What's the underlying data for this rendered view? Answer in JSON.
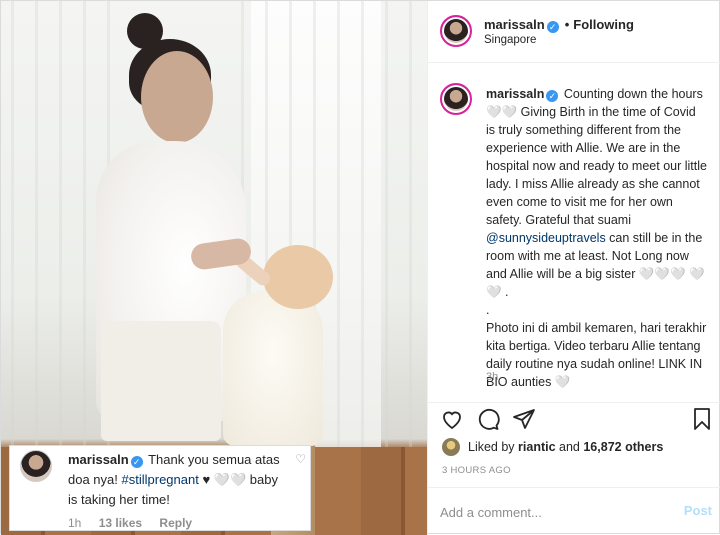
{
  "post": {
    "username": "marissaln",
    "follow_status": "Following",
    "location": "Singapore",
    "caption_pre": " Counting down the hours 🤍🤍 Giving Birth in the time of Covid is truly something different from the experience with Allie. We are in the hospital now and ready to meet our little lady. I miss Allie already as she cannot even come to visit me for her own safety. Grateful that suami ",
    "caption_mention": "@sunnysideuptravels",
    "caption_post": " can still be in the room with me at least. Not Long now and Allie will be a big sister 🤍🤍🤍 🤍🤍 .\n.\nPhoto ini di ambil kemaren, hari terakhir kita bertiga. Video terbaru Allie tentang daily routine nya sudah online! LINK IN BIO aunties 🤍",
    "caption_time": "3h",
    "liked_by_prefix": "Liked by ",
    "liked_by_user": "riantic",
    "liked_by_middle": " and ",
    "liked_by_count": "16,872 others",
    "time_ago": "3 HOURS AGO",
    "comment_placeholder": "Add a comment...",
    "post_button": "Post"
  },
  "overlay_comment": {
    "username": "marissaln",
    "text_pre": " Thank you semua atas doa nya! ",
    "hashtag": "#stillpregnant",
    "text_post": " ♥ 🤍🤍 baby is taking her time!",
    "time": "1h",
    "likes": "13 likes",
    "reply": "Reply"
  },
  "icons": {
    "verified": "verified-badge-icon",
    "like": "heart-icon",
    "comment": "comment-icon",
    "share": "paper-plane-icon",
    "save": "bookmark-icon"
  },
  "colors": {
    "verified_blue": "#3897f0",
    "link": "#00376b",
    "post_disabled": "#b2dffc",
    "story_ring": "#d6249f"
  }
}
